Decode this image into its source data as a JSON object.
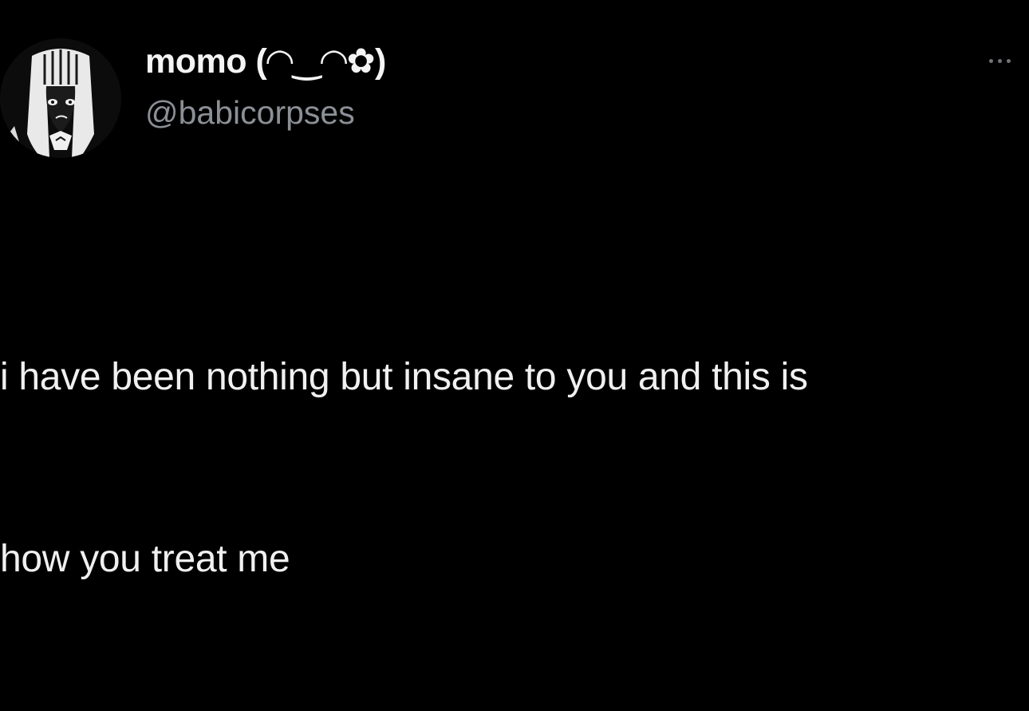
{
  "tweet": {
    "display_name": "momo (◠‿◠✿)",
    "handle": "@babicorpses",
    "text_lines": [
      "i have been nothing but insane to you and this is",
      "how you treat me"
    ]
  },
  "icons": {
    "avatar": "anime-avatar-icon",
    "more": "more-options-icon"
  },
  "colors": {
    "background": "#000000",
    "text": "#f0f0f0",
    "handle": "#8b9096"
  }
}
